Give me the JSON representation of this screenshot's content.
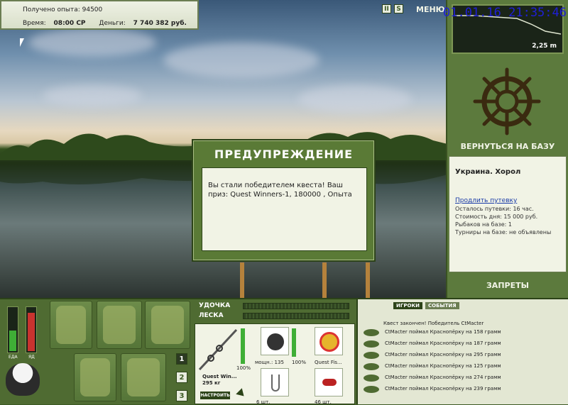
{
  "header": {
    "exp_label": "Получено опыта:",
    "exp_value": "94500",
    "time_label": "Время:",
    "time_value": "08:00 СР",
    "money_label": "Деньги:",
    "money_value": "7 740 382 руб.",
    "pause_icon": "pause-icon",
    "sound_icon": "sound-icon",
    "menu_label": "МЕНЮ",
    "clock": "01.01.16 21:35:46"
  },
  "depth": {
    "value": "2,25 m"
  },
  "right_panel": {
    "back_label": "ВЕРНУТЬСЯ НА БАЗУ",
    "location_title": "Украина. Хорол",
    "extend_link": "Продлить путевку",
    "left_time": "Осталось путевки: 16 час.",
    "day_cost": "Стоимость дня: 15 000 руб.",
    "fishers": "Рыбаков на базе: 1",
    "tournaments": "Турниры на базе: не объявлены",
    "bans_label": "ЗАПРЕТЫ"
  },
  "dialog": {
    "title": "ПРЕДУПРЕЖДЕНИЕ",
    "message": "Вы стали победителем квеста! Ваш приз: Quest Winners-1, 180000 , Опыта"
  },
  "meters": {
    "food_label": "ЕДА",
    "poison_label": "ЯД",
    "food_level": 0.45,
    "poison_level": 0.85
  },
  "pages": [
    "1",
    "2",
    "3"
  ],
  "rod_panel": {
    "rod_label": "УДОЧКА",
    "line_label": "ЛЕСКА",
    "rod_name": "Quest Win...",
    "rod_weight": "295 кг",
    "rod_percent": "100%",
    "setup_label": "НАСТРОИТЬ",
    "reel_power": "мощн.: 135",
    "reel_percent": "100%",
    "line_name": "Quest Fis...",
    "hooks_count": "6 шт.",
    "bait_count": "46 шт."
  },
  "events": {
    "tabs": [
      "ИГРОКИ",
      "СОБЫТИЯ"
    ],
    "quest_line": "Квест закончен! Победитель CtMacter",
    "rows": [
      "CtMacter поймал Краснопёрку на 158 грамм",
      "CtMacter поймал Краснопёрку на 187 грамм",
      "CtMacter поймал Краснопёрку на 295 грамм",
      "CtMacter поймал Краснопёрку на 125 грамм",
      "CtMacter поймал Краснопёрку на 274 грамм",
      "CtMacter поймал Краснопёрку на 239 грамм"
    ]
  }
}
